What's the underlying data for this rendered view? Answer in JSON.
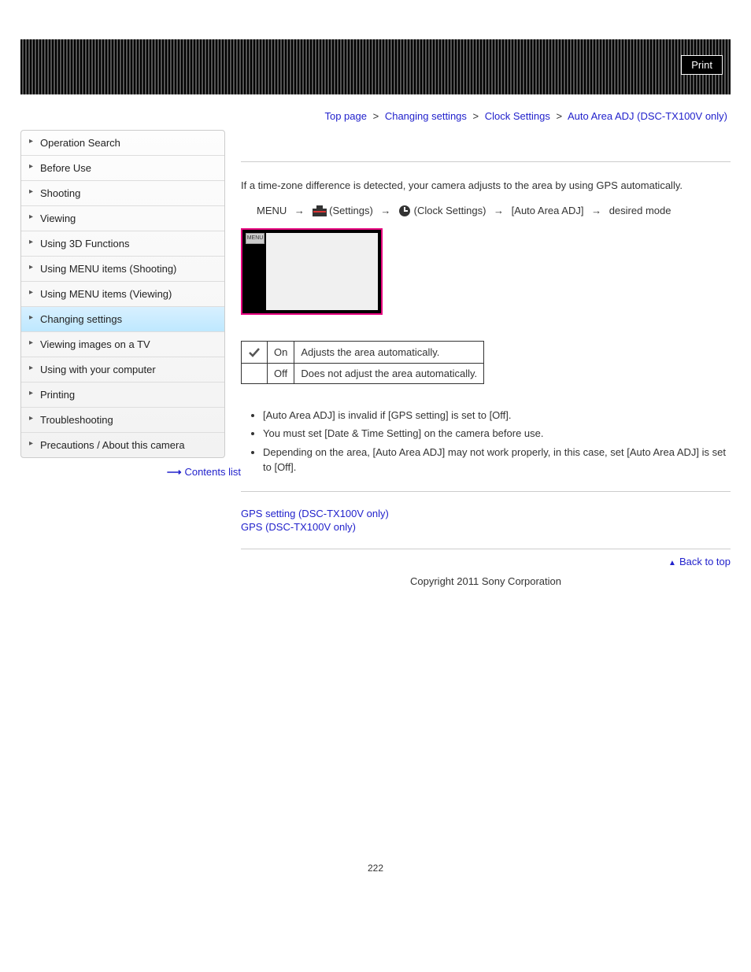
{
  "header": {
    "print_label": "Print"
  },
  "breadcrumb": {
    "top": "Top page",
    "b1": "Changing settings",
    "b2": "Clock Settings",
    "current": "Auto Area ADJ (DSC-TX100V only)"
  },
  "sidebar": {
    "items": [
      {
        "label": "Operation Search"
      },
      {
        "label": "Before Use"
      },
      {
        "label": "Shooting"
      },
      {
        "label": "Viewing"
      },
      {
        "label": "Using 3D Functions"
      },
      {
        "label": "Using MENU items (Shooting)"
      },
      {
        "label": "Using MENU items (Viewing)"
      },
      {
        "label": "Changing settings",
        "active": true
      },
      {
        "label": "Viewing images on a TV"
      },
      {
        "label": "Using with your computer"
      },
      {
        "label": "Printing"
      },
      {
        "label": "Troubleshooting"
      },
      {
        "label": "Precautions / About this camera"
      }
    ],
    "contents_link": "Contents list"
  },
  "main": {
    "intro": "If a time-zone difference is detected, your camera adjusts to the area by using GPS automatically.",
    "path": {
      "menu": "MENU",
      "settings": "(Settings)",
      "clock": "(Clock Settings)",
      "auto": "[Auto Area ADJ]",
      "desired": "desired mode"
    },
    "thumb_chip": "MENU",
    "table": {
      "r1c2": "On",
      "r1c3": "Adjusts the area automatically.",
      "r2c2": "Off",
      "r2c3": "Does not adjust the area automatically."
    },
    "notes": [
      "[Auto Area ADJ] is invalid if [GPS setting] is set to [Off].",
      "You must set [Date & Time Setting] on the camera before use.",
      "Depending on the area, [Auto Area ADJ] may not work properly, in this case, set [Auto Area ADJ] is set to [Off]."
    ],
    "related": [
      "GPS setting (DSC-TX100V only)",
      "GPS (DSC-TX100V only)"
    ],
    "back_to_top": "Back to top",
    "copyright": "Copyright 2011 Sony Corporation",
    "page_number": "222"
  }
}
